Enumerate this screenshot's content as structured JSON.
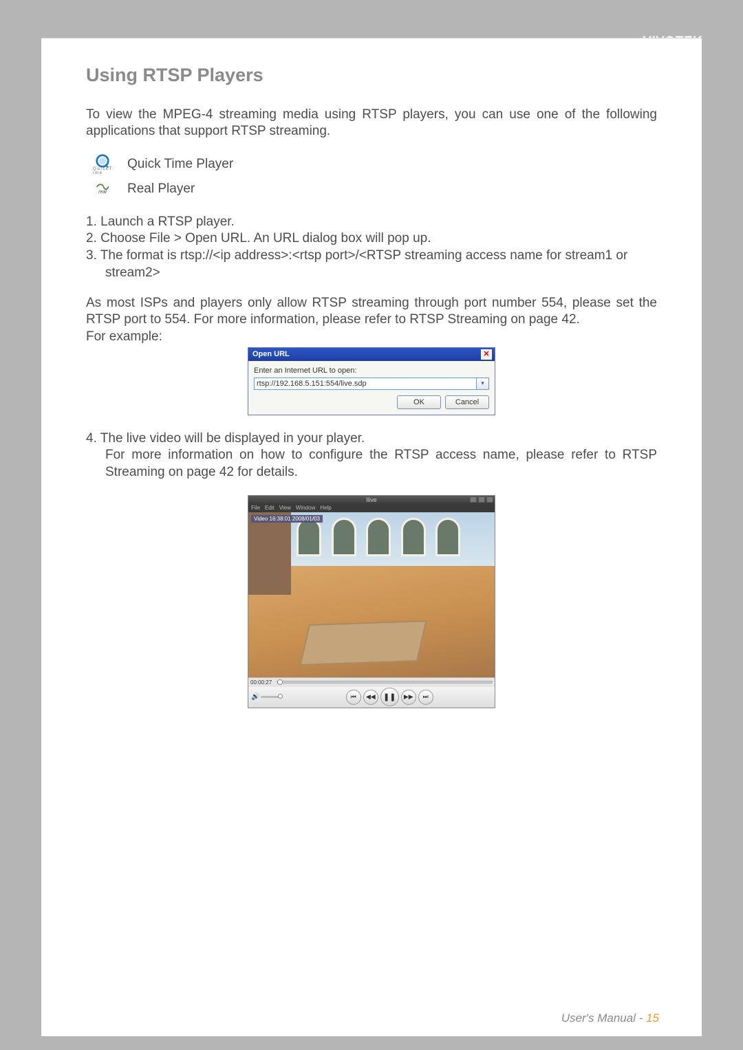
{
  "brand": "VIVOTEK",
  "heading": "Using RTSP Players",
  "intro": "To view the MPEG-4 streaming media using RTSP players, you can use one of the following applications that support RTSP streaming.",
  "apps": [
    {
      "label": "Quick Time Player",
      "icon_sub": "Q u i c k T i m e"
    },
    {
      "label": "Real Player",
      "icon_sub": "real"
    }
  ],
  "steps_a": [
    "1. Launch a RTSP player.",
    "2. Choose File > Open URL. An URL dialog box will pop up.",
    "3. The format is rtsp://<ip address>:<rtsp port>/<RTSP streaming access name for stream1 or stream2>"
  ],
  "para2": "As most ISPs and players only allow RTSP streaming through port number 554, please set the RTSP port to 554. For more information, please refer to RTSP Streaming on page 42.",
  "for_example": "For example:",
  "open_url": {
    "title": "Open URL",
    "prompt": "Enter an Internet URL to open:",
    "value": "rtsp://192.168.5.151:554/live.sdp",
    "ok": "OK",
    "cancel": "Cancel"
  },
  "steps_b": [
    "4. The live video will be displayed in your player.",
    "For more information on how to configure the RTSP access name, please refer to RTSP Streaming on page 42 for details."
  ],
  "player": {
    "title": "llive",
    "menu": [
      "File",
      "Edit",
      "View",
      "Window",
      "Help"
    ],
    "overlay": "Video 16:38:01 2008/01/03",
    "time": "00:00:27"
  },
  "footer": {
    "label": "User's Manual - ",
    "page": "15"
  }
}
